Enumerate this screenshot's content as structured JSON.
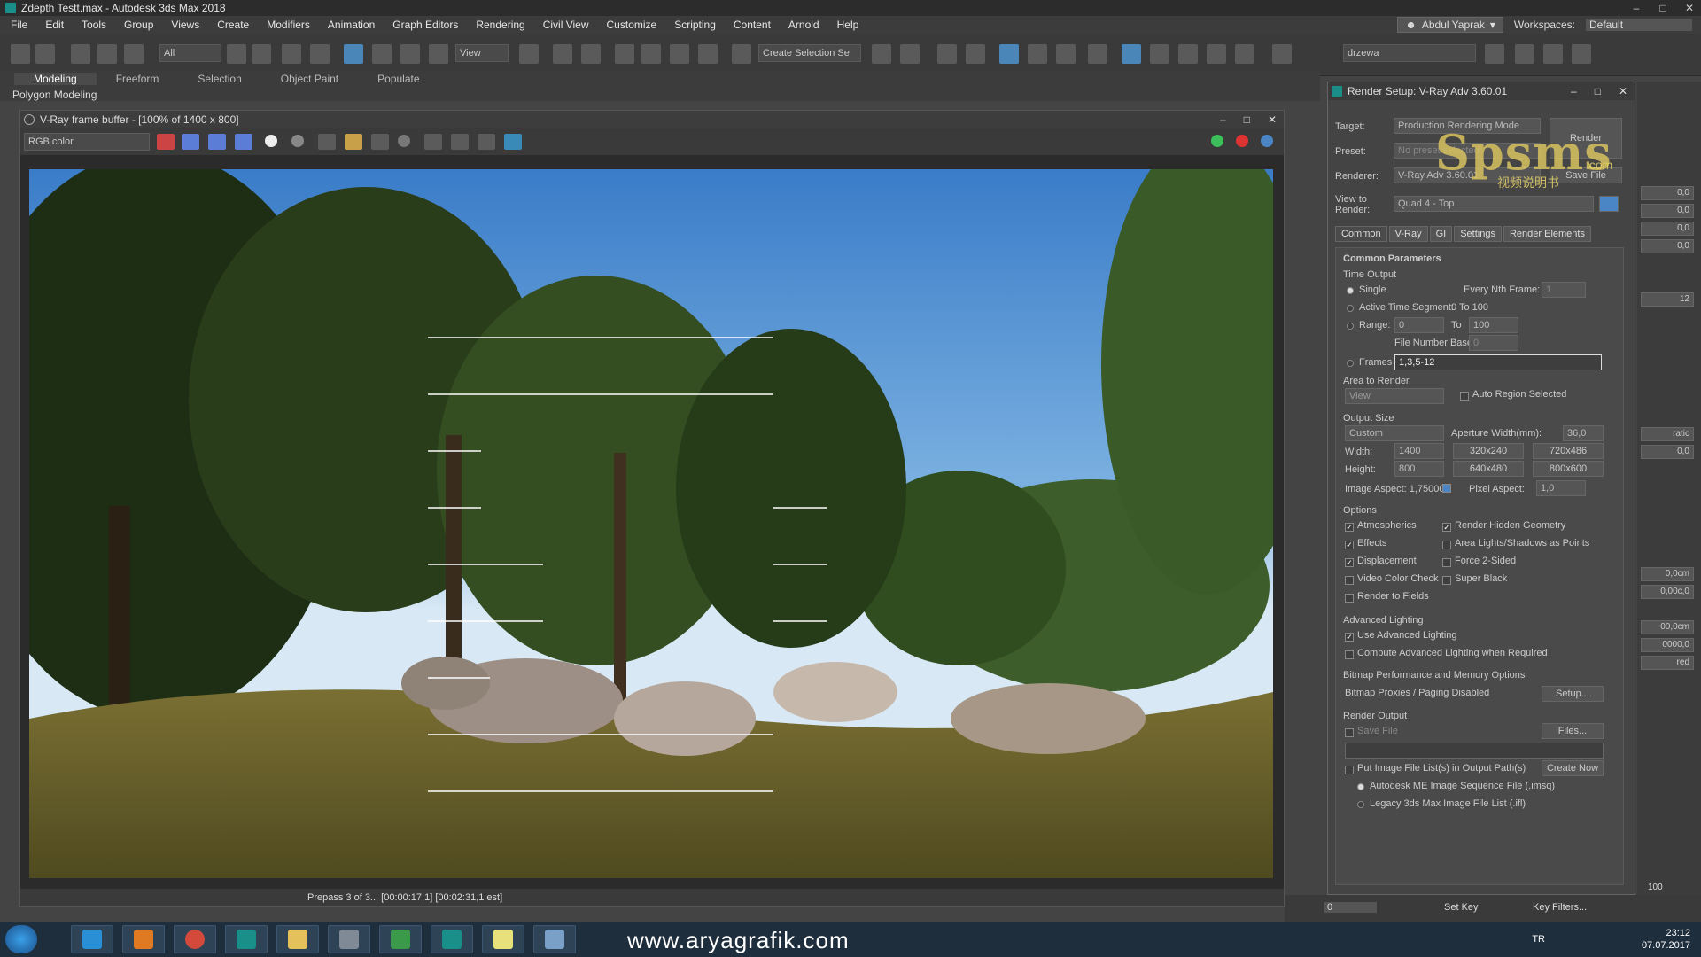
{
  "window": {
    "title": "Zdepth Testt.max - Autodesk 3ds Max 2018"
  },
  "menu": [
    "File",
    "Edit",
    "Tools",
    "Group",
    "Views",
    "Create",
    "Modifiers",
    "Animation",
    "Graph Editors",
    "Rendering",
    "Civil View",
    "Customize",
    "Scripting",
    "Content",
    "Arnold",
    "Help"
  ],
  "user": {
    "name": "Abdul Yaprak",
    "workspaces_label": "Workspaces:",
    "workspace": "Default"
  },
  "toolbar": {
    "filter": "All",
    "view": "View",
    "selection_set": "Create Selection Se",
    "layer": "drzewa"
  },
  "ribbon": {
    "tabs": [
      "Modeling",
      "Freeform",
      "Selection",
      "Object Paint",
      "Populate"
    ],
    "sub": "Polygon Modeling"
  },
  "vfb": {
    "title": "V-Ray frame buffer - [100% of 1400 x 800]",
    "channel": "RGB color",
    "status": "Prepass 3 of 3... [00:00:17,1] [00:02:31,1 est]"
  },
  "render_setup": {
    "title": "Render Setup: V-Ray Adv 3.60.01",
    "target_label": "Target:",
    "target": "Production Rendering Mode",
    "preset_label": "Preset:",
    "preset": "No preset selected",
    "renderer_label": "Renderer:",
    "renderer": "V-Ray Adv 3.60.01",
    "save_file_btn": "Save File",
    "view_label": "View to Render:",
    "view": "Quad 4 - Top",
    "render_btn": "Render",
    "tabs": [
      "Common",
      "V-Ray",
      "GI",
      "Settings",
      "Render Elements"
    ],
    "common_params": "Common Parameters",
    "time_output": "Time Output",
    "single": "Single",
    "every_nth": "Every Nth Frame:",
    "every_nth_val": "1",
    "active_segment": "Active Time Segment:",
    "active_segment_val": "0 To 100",
    "range": "Range:",
    "range_from": "0",
    "range_to_label": "To",
    "range_to": "100",
    "file_number_base": "File Number Base:",
    "file_number_base_val": "0",
    "frames": "Frames",
    "frames_val": "1,3,5-12",
    "area_to_render": "Area to Render",
    "area": "View",
    "auto_region": "Auto Region Selected",
    "output_size": "Output Size",
    "size_preset": "Custom",
    "aperture": "Aperture Width(mm):",
    "aperture_val": "36,0",
    "width_label": "Width:",
    "width": "1400",
    "height_label": "Height:",
    "height": "800",
    "presets": [
      "320x240",
      "720x486",
      "640x480",
      "800x600"
    ],
    "image_aspect": "Image Aspect: 1,75000",
    "pixel_aspect": "Pixel Aspect:",
    "pixel_aspect_val": "1,0",
    "options": "Options",
    "opt_atmospherics": "Atmospherics",
    "opt_hidden_geom": "Render Hidden Geometry",
    "opt_effects": "Effects",
    "opt_area_lights": "Area Lights/Shadows as Points",
    "opt_displacement": "Displacement",
    "opt_force2": "Force 2-Sided",
    "opt_video": "Video Color Check",
    "opt_superblack": "Super Black",
    "opt_fields": "Render to Fields",
    "adv_lighting": "Advanced Lighting",
    "use_adv": "Use Advanced Lighting",
    "compute_adv": "Compute Advanced Lighting when Required",
    "bitmap_perf": "Bitmap Performance and Memory Options",
    "bitmap_proxies": "Bitmap Proxies / Paging Disabled",
    "setup_btn": "Setup...",
    "render_output": "Render Output",
    "save_file": "Save File",
    "files_btn": "Files...",
    "put_image": "Put Image File List(s) in Output Path(s)",
    "create_now": "Create Now",
    "autodesk_me": "Autodesk ME Image Sequence File (.imsq)",
    "legacy": "Legacy 3ds Max Image File List (.ifl)"
  },
  "watermark": {
    "logo": "Spsms",
    "com": ".com",
    "sub": "视频说明书"
  },
  "cmd_fields": [
    "0,0",
    "0,0",
    "0,0",
    "0,0",
    "12",
    "ratic",
    "0,0",
    "0,0cm",
    "0,00c,0",
    "00,0cm",
    "0000,0",
    "red"
  ],
  "timeline": {
    "frame": "0",
    "set_key": "Set Key",
    "key_filters": "Key Filters...",
    "end": "100"
  },
  "taskbar": {
    "url": "www.aryagrafik.com",
    "lang": "TR",
    "time": "23:12",
    "date": "07.07.2017"
  }
}
